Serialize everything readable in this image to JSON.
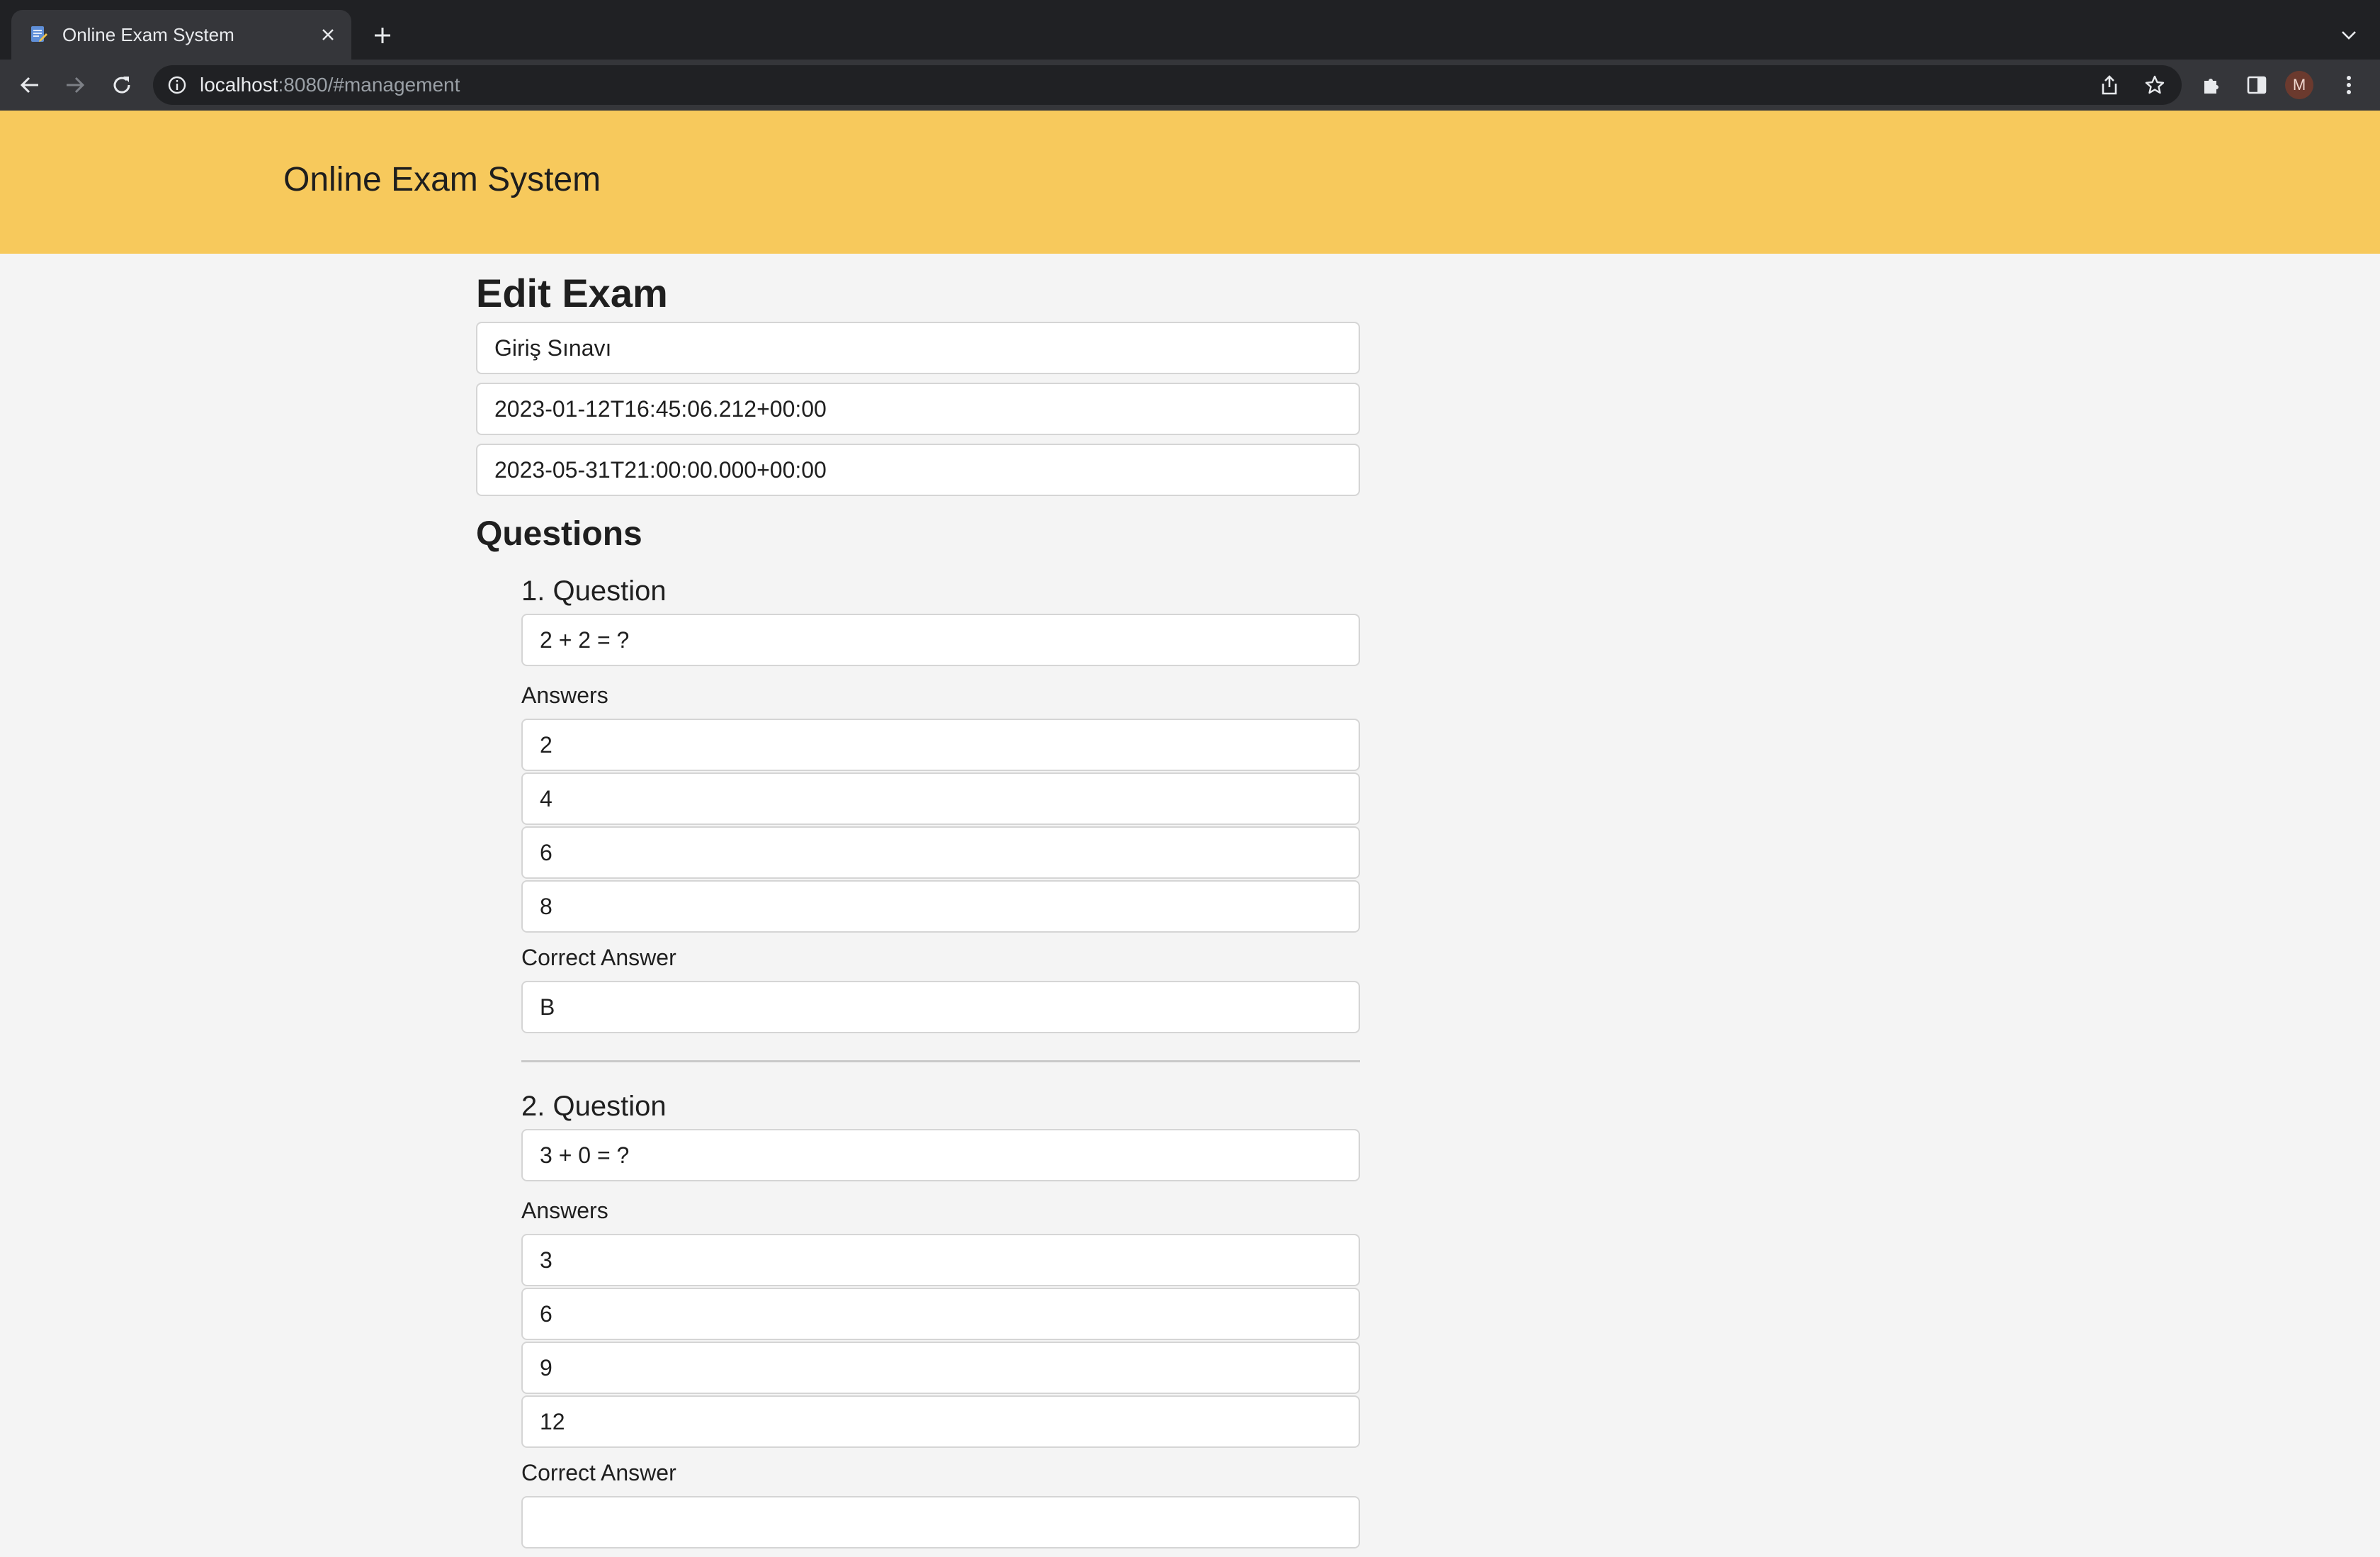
{
  "browser": {
    "tab_title": "Online Exam System",
    "url_host": "localhost",
    "url_rest": ":8080/#management",
    "profile_initial": "M"
  },
  "app": {
    "title": "Online Exam System"
  },
  "exam": {
    "heading": "Edit Exam",
    "name": "Giriş Sınavı",
    "start_date": "2023-01-12T16:45:06.212+00:00",
    "end_date": "2023-05-31T21:00:00.000+00:00",
    "questions_heading": "Questions",
    "answers_label": "Answers",
    "correct_label": "Correct Answer",
    "questions": [
      {
        "title": "1. Question",
        "text": "2 + 2 = ?",
        "answers": [
          "2",
          "4",
          "6",
          "8"
        ],
        "correct": "B"
      },
      {
        "title": "2. Question",
        "text": "3 + 0 = ?",
        "answers": [
          "3",
          "6",
          "9",
          "12"
        ],
        "correct": ""
      }
    ]
  },
  "colors": {
    "header_bg": "#f7c95c",
    "page_bg": "#f4f4f4",
    "chrome_dark": "#202124",
    "chrome_toolbar": "#35363a"
  }
}
